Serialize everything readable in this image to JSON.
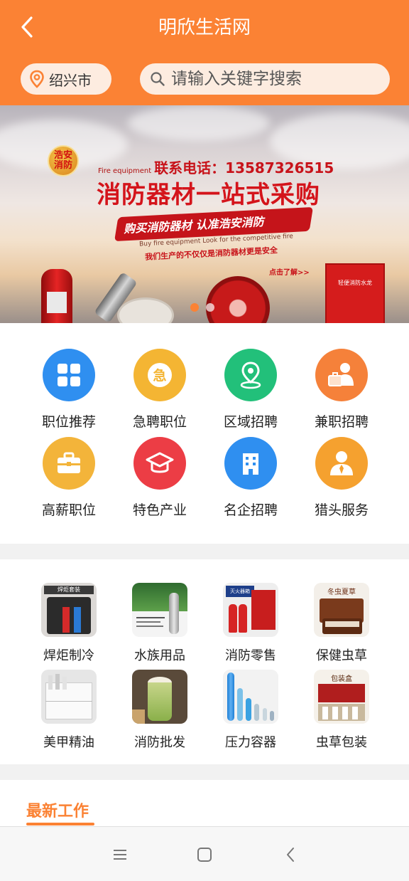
{
  "header": {
    "title": "明欣生活网",
    "city": "绍兴市",
    "search_placeholder": "请输入关键字搜索",
    "accent": "#fb8234"
  },
  "banner": {
    "logo_text": "浩安消防",
    "phone_en": "Fire equipment",
    "phone_text": "联系电话：13587326515",
    "headline": "消防器材一站式采购",
    "slogan": "购买消防器材 认准浩安消防",
    "en_sub": "Buy fire equipment Look for the competitive fire",
    "cn_sub": "我们生产的不仅仅是消防器材更是安全",
    "click_more": "点击了解>>",
    "cabinet_label": "轻便消防水龙",
    "slides": 2,
    "active_slide": 1
  },
  "categories": [
    {
      "label": "职位推荐",
      "icon": "grid-apps-icon",
      "color": "#2f8ff0"
    },
    {
      "label": "急聘职位",
      "icon": "urgent-icon",
      "color": "#f4b533"
    },
    {
      "label": "区域招聘",
      "icon": "location-pin-icon",
      "color": "#22c07a"
    },
    {
      "label": "兼职招聘",
      "icon": "person-briefcase-icon",
      "color": "#f5813a"
    },
    {
      "label": "高薪职位",
      "icon": "briefcase-icon",
      "color": "#f3b43a"
    },
    {
      "label": "特色产业",
      "icon": "graduation-cap-icon",
      "color": "#ec3d45"
    },
    {
      "label": "名企招聘",
      "icon": "office-building-icon",
      "color": "#2f8ff0"
    },
    {
      "label": "猎头服务",
      "icon": "business-person-icon",
      "color": "#f5a12f"
    }
  ],
  "products": [
    {
      "label": "焊炬制冷",
      "icon": "welding-kit-image"
    },
    {
      "label": "水族用品",
      "icon": "aquarium-image"
    },
    {
      "label": "消防零售",
      "icon": "fire-extinguisher-box-image"
    },
    {
      "label": "保健虫草",
      "icon": "cordyceps-gift-box-image"
    },
    {
      "label": "美甲精油",
      "icon": "cosmetic-organizer-image"
    },
    {
      "label": "消防批发",
      "icon": "matcha-drink-image"
    },
    {
      "label": "压力容器",
      "icon": "gas-cylinders-image"
    },
    {
      "label": "虫草包装",
      "icon": "packaging-box-image"
    }
  ],
  "product_tags": {
    "p0": "焊炬套装",
    "p2": "灭火器箱",
    "p3": "冬虫夏草",
    "p7": "包装盒"
  },
  "latest": {
    "title": "最新工作"
  }
}
